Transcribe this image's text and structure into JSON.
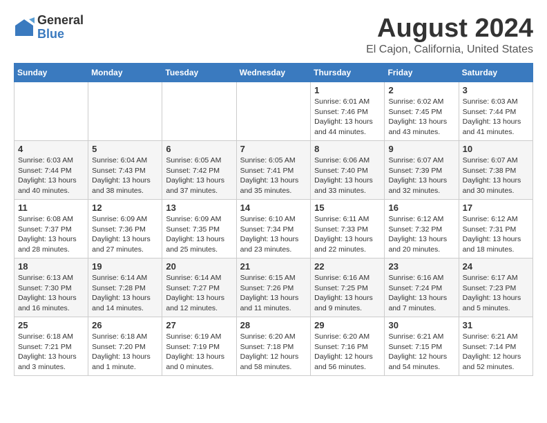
{
  "logo": {
    "general": "General",
    "blue": "Blue"
  },
  "title": "August 2024",
  "location": "El Cajon, California, United States",
  "days_of_week": [
    "Sunday",
    "Monday",
    "Tuesday",
    "Wednesday",
    "Thursday",
    "Friday",
    "Saturday"
  ],
  "weeks": [
    [
      {
        "day": "",
        "info": ""
      },
      {
        "day": "",
        "info": ""
      },
      {
        "day": "",
        "info": ""
      },
      {
        "day": "",
        "info": ""
      },
      {
        "day": "1",
        "info": "Sunrise: 6:01 AM\nSunset: 7:46 PM\nDaylight: 13 hours\nand 44 minutes."
      },
      {
        "day": "2",
        "info": "Sunrise: 6:02 AM\nSunset: 7:45 PM\nDaylight: 13 hours\nand 43 minutes."
      },
      {
        "day": "3",
        "info": "Sunrise: 6:03 AM\nSunset: 7:44 PM\nDaylight: 13 hours\nand 41 minutes."
      }
    ],
    [
      {
        "day": "4",
        "info": "Sunrise: 6:03 AM\nSunset: 7:44 PM\nDaylight: 13 hours\nand 40 minutes."
      },
      {
        "day": "5",
        "info": "Sunrise: 6:04 AM\nSunset: 7:43 PM\nDaylight: 13 hours\nand 38 minutes."
      },
      {
        "day": "6",
        "info": "Sunrise: 6:05 AM\nSunset: 7:42 PM\nDaylight: 13 hours\nand 37 minutes."
      },
      {
        "day": "7",
        "info": "Sunrise: 6:05 AM\nSunset: 7:41 PM\nDaylight: 13 hours\nand 35 minutes."
      },
      {
        "day": "8",
        "info": "Sunrise: 6:06 AM\nSunset: 7:40 PM\nDaylight: 13 hours\nand 33 minutes."
      },
      {
        "day": "9",
        "info": "Sunrise: 6:07 AM\nSunset: 7:39 PM\nDaylight: 13 hours\nand 32 minutes."
      },
      {
        "day": "10",
        "info": "Sunrise: 6:07 AM\nSunset: 7:38 PM\nDaylight: 13 hours\nand 30 minutes."
      }
    ],
    [
      {
        "day": "11",
        "info": "Sunrise: 6:08 AM\nSunset: 7:37 PM\nDaylight: 13 hours\nand 28 minutes."
      },
      {
        "day": "12",
        "info": "Sunrise: 6:09 AM\nSunset: 7:36 PM\nDaylight: 13 hours\nand 27 minutes."
      },
      {
        "day": "13",
        "info": "Sunrise: 6:09 AM\nSunset: 7:35 PM\nDaylight: 13 hours\nand 25 minutes."
      },
      {
        "day": "14",
        "info": "Sunrise: 6:10 AM\nSunset: 7:34 PM\nDaylight: 13 hours\nand 23 minutes."
      },
      {
        "day": "15",
        "info": "Sunrise: 6:11 AM\nSunset: 7:33 PM\nDaylight: 13 hours\nand 22 minutes."
      },
      {
        "day": "16",
        "info": "Sunrise: 6:12 AM\nSunset: 7:32 PM\nDaylight: 13 hours\nand 20 minutes."
      },
      {
        "day": "17",
        "info": "Sunrise: 6:12 AM\nSunset: 7:31 PM\nDaylight: 13 hours\nand 18 minutes."
      }
    ],
    [
      {
        "day": "18",
        "info": "Sunrise: 6:13 AM\nSunset: 7:30 PM\nDaylight: 13 hours\nand 16 minutes."
      },
      {
        "day": "19",
        "info": "Sunrise: 6:14 AM\nSunset: 7:28 PM\nDaylight: 13 hours\nand 14 minutes."
      },
      {
        "day": "20",
        "info": "Sunrise: 6:14 AM\nSunset: 7:27 PM\nDaylight: 13 hours\nand 12 minutes."
      },
      {
        "day": "21",
        "info": "Sunrise: 6:15 AM\nSunset: 7:26 PM\nDaylight: 13 hours\nand 11 minutes."
      },
      {
        "day": "22",
        "info": "Sunrise: 6:16 AM\nSunset: 7:25 PM\nDaylight: 13 hours\nand 9 minutes."
      },
      {
        "day": "23",
        "info": "Sunrise: 6:16 AM\nSunset: 7:24 PM\nDaylight: 13 hours\nand 7 minutes."
      },
      {
        "day": "24",
        "info": "Sunrise: 6:17 AM\nSunset: 7:23 PM\nDaylight: 13 hours\nand 5 minutes."
      }
    ],
    [
      {
        "day": "25",
        "info": "Sunrise: 6:18 AM\nSunset: 7:21 PM\nDaylight: 13 hours\nand 3 minutes."
      },
      {
        "day": "26",
        "info": "Sunrise: 6:18 AM\nSunset: 7:20 PM\nDaylight: 13 hours\nand 1 minute."
      },
      {
        "day": "27",
        "info": "Sunrise: 6:19 AM\nSunset: 7:19 PM\nDaylight: 13 hours\nand 0 minutes."
      },
      {
        "day": "28",
        "info": "Sunrise: 6:20 AM\nSunset: 7:18 PM\nDaylight: 12 hours\nand 58 minutes."
      },
      {
        "day": "29",
        "info": "Sunrise: 6:20 AM\nSunset: 7:16 PM\nDaylight: 12 hours\nand 56 minutes."
      },
      {
        "day": "30",
        "info": "Sunrise: 6:21 AM\nSunset: 7:15 PM\nDaylight: 12 hours\nand 54 minutes."
      },
      {
        "day": "31",
        "info": "Sunrise: 6:21 AM\nSunset: 7:14 PM\nDaylight: 12 hours\nand 52 minutes."
      }
    ]
  ]
}
